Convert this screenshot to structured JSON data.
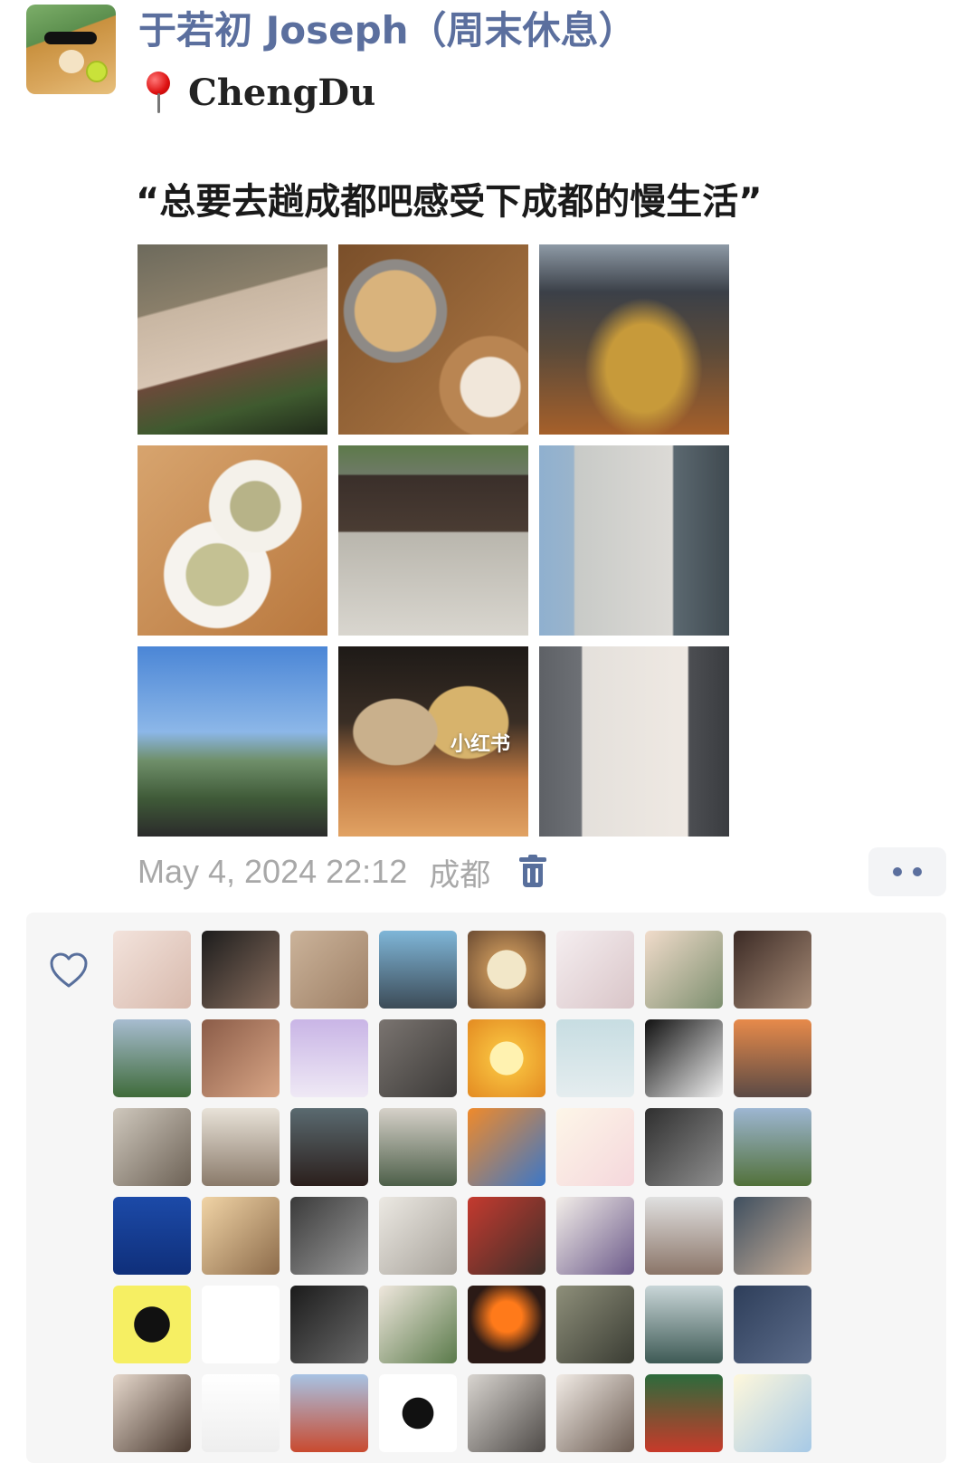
{
  "post": {
    "author_name": "于若初 Joseph（周末休息）",
    "location": "ChengDu",
    "caption": "“总要去趟成都吧感受下成都的慢生活”",
    "timestamp": "May 4, 2024 22:12",
    "place_tag": "成都",
    "photo_watermark": "小红书"
  },
  "icons": {
    "avatar": "shiba-dog-sunglasses-avatar",
    "pin": "location-pin-icon",
    "trash": "trash-icon",
    "more": "more-dots-icon",
    "heart": "heart-outline-icon"
  },
  "colors": {
    "name": "#5b6f9e",
    "meta_text": "#a8a8a8",
    "accent": "#586f9c",
    "likes_bg": "#f6f6f6"
  },
  "photos": [
    {
      "name": "photo-teahouse-awning",
      "bg": "linear-gradient(165deg,#6d6a5c 0%,#8a7f6a 30%,#c8b6a2 31%,#d8c6b4 60%,#6b4a3a 61%,#3f5a2f 80%,#202a1a 100%)"
    },
    {
      "name": "photo-noodle-bowls",
      "bg": "radial-gradient(circle at 30% 35%,#d9b37c 0 22%,#8e8a86 23% 28%,transparent 29%),radial-gradient(circle at 80% 75%,#f1e7da 0 14%,#b98552 15% 24%,transparent 25%),linear-gradient(135deg,#7a4f2a,#b07a45)"
    },
    {
      "name": "photo-crowded-feast",
      "bg": "radial-gradient(ellipse at 55% 65%,#c79a3a 0 25%,transparent 40%),linear-gradient(180deg,#8e9aa6 0%,#3b4048 25%,#5a4a3a 55%,#a6602a 100%)"
    },
    {
      "name": "photo-tea-cups",
      "bg": "radial-gradient(circle at 62% 32%,#b7b388 0 14%,#f4f1ea 15% 26%,transparent 27%),radial-gradient(circle at 42% 68%,#c4c193 0 18%,#f6f3ee 19% 31%,transparent 32%),linear-gradient(135deg,#d7a46e,#b9783e)"
    },
    {
      "name": "photo-park-gate-man",
      "bg": "linear-gradient(180deg,#5d7a4a 0%,#6e7a66 15%,#3a2f2a 16%,#4a3c33 45%,#b9b6ad 46%,#d9d6cf 100%)"
    },
    {
      "name": "photo-peoples-park-pillar",
      "bg": "linear-gradient(90deg,#8fb0cf 0%,#9ab4cc 18%,#c8cac7 19%,#dcdad6 70%,#5b6870 71%,#404a50 100%)"
    },
    {
      "name": "photo-city-skyline",
      "bg": "linear-gradient(180deg,#4b86d6 0%,#8cb7e8 45%,#6f8f6a 60%,#3f5a38 80%,#2b2b2b 100%)"
    },
    {
      "name": "photo-milk-tea-cups",
      "bg": "radial-gradient(ellipse at 30% 45%,#c9b08c 0 22%,transparent 23%),radial-gradient(ellipse at 68% 40%,#d7b36c 0 22%,transparent 23%),linear-gradient(180deg,#1e1a17 0%,#3a2e25 40%,#c27b43 70%,#e1a263 100%)"
    },
    {
      "name": "photo-panda-mural",
      "bg": "linear-gradient(90deg,#5e6166 0%,#6d7075 22%,#e4e0db 23%,#efe9e3 78%,#4c4e52 79%,#3a3c40 100%)"
    }
  ],
  "likers": [
    {
      "name": "liker-avatar",
      "bg": "linear-gradient(135deg,#f3e3dc,#d7b9ac)"
    },
    {
      "name": "liker-avatar",
      "bg": "linear-gradient(135deg,#1c1c1c,#8a6f5f)"
    },
    {
      "name": "liker-avatar",
      "bg": "linear-gradient(135deg,#cbb39a,#9e8066)"
    },
    {
      "name": "liker-avatar",
      "bg": "linear-gradient(180deg,#7fb6d8,#3c4b57)"
    },
    {
      "name": "liker-avatar",
      "bg": "radial-gradient(circle,#f2e7c8 0 35%,#b98a54 36%,#6b4b32)"
    },
    {
      "name": "liker-avatar",
      "bg": "linear-gradient(135deg,#f5eef0,#d9c5c8)"
    },
    {
      "name": "liker-avatar",
      "bg": "linear-gradient(135deg,#f1dccb,#7d8f6f)"
    },
    {
      "name": "liker-avatar",
      "bg": "linear-gradient(135deg,#3b2a25,#a98d78)"
    },
    {
      "name": "liker-avatar",
      "bg": "linear-gradient(180deg,#a7bcd0,#3f6b3a)"
    },
    {
      "name": "liker-avatar",
      "bg": "linear-gradient(135deg,#8b5c48,#d9a686)"
    },
    {
      "name": "liker-avatar",
      "bg": "linear-gradient(180deg,#c9b5e6,#efe9f5)"
    },
    {
      "name": "liker-avatar",
      "bg": "linear-gradient(135deg,#7a7470,#3c3a38)"
    },
    {
      "name": "liker-avatar",
      "bg": "radial-gradient(circle,#fff2b0 0 30%,#f5b93b 31%,#e38a21)"
    },
    {
      "name": "liker-avatar",
      "bg": "linear-gradient(180deg,#c7dde2,#e5edef)"
    },
    {
      "name": "liker-avatar",
      "bg": "linear-gradient(135deg,#111,#f1f1f1)"
    },
    {
      "name": "liker-avatar",
      "bg": "linear-gradient(180deg,#e78a4a,#5b4a45)"
    },
    {
      "name": "liker-avatar",
      "bg": "linear-gradient(135deg,#cfc8bd,#6d6256)"
    },
    {
      "name": "liker-avatar",
      "bg": "linear-gradient(180deg,#e8e2d8,#8a7a6a)"
    },
    {
      "name": "liker-avatar",
      "bg": "linear-gradient(180deg,#5a6a70,#2b1f1c)"
    },
    {
      "name": "liker-avatar",
      "bg": "linear-gradient(180deg,#d6d1c9,#4d5f49)"
    },
    {
      "name": "liker-avatar",
      "bg": "linear-gradient(135deg,#f08a2a,#3b77c8)"
    },
    {
      "name": "liker-avatar",
      "bg": "linear-gradient(135deg,#fdf6e8,#f5d7dc)"
    },
    {
      "name": "liker-avatar",
      "bg": "linear-gradient(135deg,#2f2f2f,#8f8f8f)"
    },
    {
      "name": "liker-avatar",
      "bg": "linear-gradient(180deg,#9db6d2,#52713a)"
    },
    {
      "name": "liker-avatar",
      "bg": "linear-gradient(180deg,#1c4aa8,#0f2f7a)"
    },
    {
      "name": "liker-avatar",
      "bg": "linear-gradient(135deg,#f1d4a6,#8c6b4a)"
    },
    {
      "name": "liker-avatar",
      "bg": "linear-gradient(135deg,#3a3a3a,#9a9a9a)"
    },
    {
      "name": "liker-avatar",
      "bg": "linear-gradient(135deg,#ece9e3,#a7a29a)"
    },
    {
      "name": "liker-avatar",
      "bg": "linear-gradient(135deg,#c53a2f,#3c2f2a)"
    },
    {
      "name": "liker-avatar",
      "bg": "linear-gradient(135deg,#f3eee9,#6c5a8a)"
    },
    {
      "name": "liker-avatar",
      "bg": "linear-gradient(180deg,#e0e0e0,#8b7568)"
    },
    {
      "name": "liker-avatar",
      "bg": "linear-gradient(135deg,#3f4f5f,#c9b09a)"
    },
    {
      "name": "liker-avatar",
      "bg": "radial-gradient(circle,#111 0 32%,#f6ef63 33%)"
    },
    {
      "name": "liker-avatar",
      "bg": "#ffffff"
    },
    {
      "name": "liker-avatar",
      "bg": "linear-gradient(135deg,#1b1b1b,#6a6a6a)"
    },
    {
      "name": "liker-avatar",
      "bg": "linear-gradient(135deg,#efe7dd,#5a7a4a)"
    },
    {
      "name": "liker-avatar",
      "bg": "radial-gradient(circle at 50% 40%,#ff7a1a 0 25%,#2b1a16 60%)"
    },
    {
      "name": "liker-avatar",
      "bg": "linear-gradient(135deg,#8e8f7a,#3a3c33)"
    },
    {
      "name": "liker-avatar",
      "bg": "linear-gradient(180deg,#c9d6d8,#3e5a55)"
    },
    {
      "name": "liker-avatar",
      "bg": "linear-gradient(135deg,#2e3e5a,#5c6c8a)"
    },
    {
      "name": "liker-avatar",
      "bg": "linear-gradient(135deg,#e6d8cc,#4a3a30)"
    },
    {
      "name": "liker-avatar",
      "bg": "linear-gradient(180deg,#ffffff,#eeeeee)"
    },
    {
      "name": "liker-avatar",
      "bg": "linear-gradient(180deg,#a7c3e4,#c94a2f)"
    },
    {
      "name": "liker-avatar",
      "bg": "radial-gradient(circle,#111 0 28%,#ffffff 29%)"
    },
    {
      "name": "liker-avatar",
      "bg": "linear-gradient(135deg,#d9d5d0,#4e4a47)"
    },
    {
      "name": "liker-avatar",
      "bg": "linear-gradient(135deg,#f2ece6,#6a5a50)"
    },
    {
      "name": "liker-avatar",
      "bg": "linear-gradient(180deg,#2c6b3c,#c83a2a)"
    },
    {
      "name": "liker-avatar",
      "bg": "linear-gradient(135deg,#fff8dc,#a6c9e6)"
    }
  ]
}
